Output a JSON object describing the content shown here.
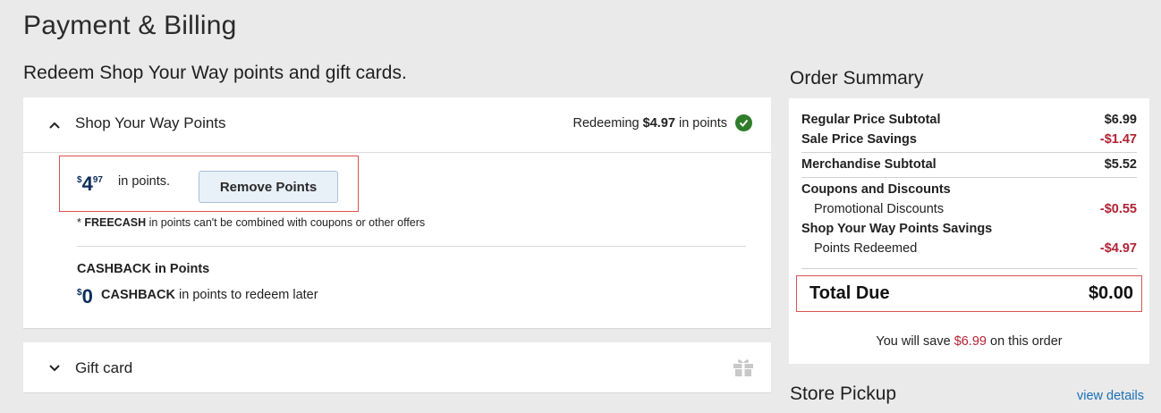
{
  "page": {
    "title": "Payment & Billing",
    "section_heading": "Redeem Shop Your Way points and gift cards."
  },
  "syw": {
    "title": "Shop Your Way Points",
    "redeeming_prefix": "Redeeming ",
    "redeeming_amount": "$4.97",
    "redeeming_suffix": " in points",
    "amount_dollar": "$",
    "amount_whole": "4",
    "amount_cents": "97",
    "in_points": "in points.",
    "remove_label": "Remove Points",
    "disclaimer_prefix": "* ",
    "disclaimer_bold": "FREECASH",
    "disclaimer_rest": " in points can't be combined with coupons or other offers",
    "cashback_title": "CASHBACK in Points",
    "cashback_dollar": "$",
    "cashback_whole": "0",
    "cashback_bold": "CASHBACK",
    "cashback_rest": " in points to redeem later"
  },
  "gift": {
    "title": "Gift card"
  },
  "summary": {
    "title": "Order Summary",
    "rows": [
      {
        "label": "Regular Price Subtotal",
        "value": "$6.99"
      },
      {
        "label": "Sale Price Savings",
        "value": "-$1.47"
      },
      {
        "label": "Merchandise Subtotal",
        "value": "$5.52"
      },
      {
        "label": "Coupons and Discounts",
        "value": ""
      },
      {
        "label": "Promotional Discounts",
        "value": "-$0.55"
      },
      {
        "label": "Shop Your Way Points Savings",
        "value": ""
      },
      {
        "label": "Points Redeemed",
        "value": "-$4.97"
      }
    ],
    "total_label": "Total Due",
    "total_value": "$0.00",
    "save_prefix": "You will save ",
    "save_amount": "$6.99",
    "save_suffix": " on this order"
  },
  "pickup": {
    "title": "Store Pickup",
    "link": "view details"
  },
  "colors": {
    "accent_red": "#b22234",
    "highlight_border": "#d9534f",
    "check_green": "#2f7d2a",
    "link_blue": "#1a6fb5",
    "points_navy": "#0d2d5a"
  },
  "icons": {
    "collapse": "chevron-up-icon",
    "expand": "chevron-down-icon",
    "status": "check-circle-icon",
    "gift": "gift-icon"
  }
}
